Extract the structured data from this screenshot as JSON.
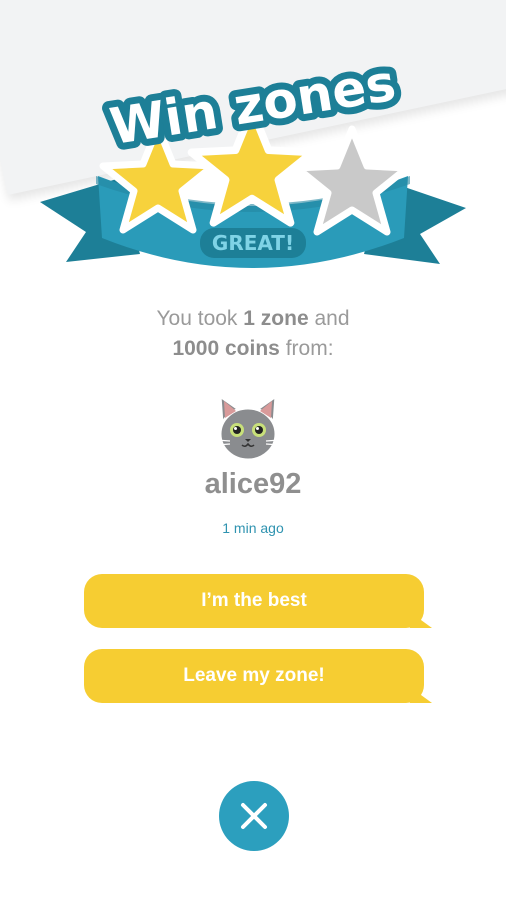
{
  "banner": {
    "title": "Win zones",
    "rating_label": "GREAT!",
    "stars_filled": 2,
    "stars_total": 3
  },
  "result": {
    "prefix": "You took ",
    "zones": "1 zone",
    "middle": " and",
    "coins": "1000 coins",
    "suffix": " from:"
  },
  "opponent": {
    "avatar_icon": "cat-avatar-icon",
    "username": "alice92",
    "time_ago": "1 min ago"
  },
  "actions": {
    "reply_1": "I’m the best",
    "reply_2": "Leave my zone!",
    "close_icon": "close-icon"
  },
  "colors": {
    "accent": "#2c9fbe",
    "button": "#f6cd32",
    "star_filled": "#f7d23c",
    "star_empty": "#c9c9c9"
  }
}
